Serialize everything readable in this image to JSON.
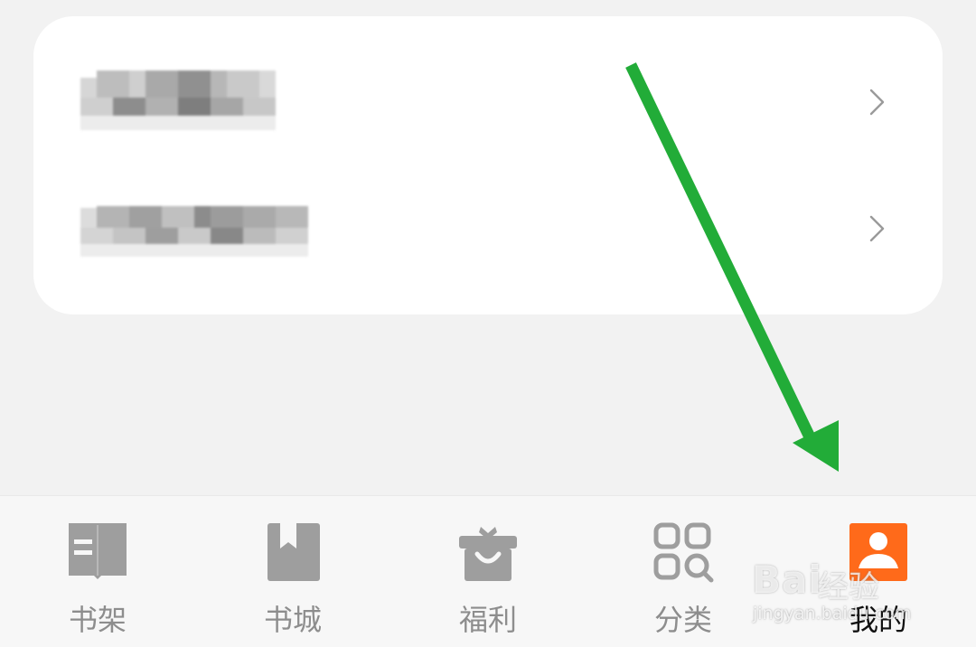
{
  "list": {
    "rows": [
      {
        "label": "",
        "chevron_icon": "chevron-right-icon"
      },
      {
        "label": "",
        "chevron_icon": "chevron-right-icon"
      }
    ]
  },
  "tabbar": {
    "active_color": "#ff6a1a",
    "tabs": [
      {
        "label": "书架",
        "icon": "bookshelf-icon",
        "active": false
      },
      {
        "label": "书城",
        "icon": "bookstore-icon",
        "active": false
      },
      {
        "label": "福利",
        "icon": "gift-icon",
        "active": false
      },
      {
        "label": "分类",
        "icon": "category-icon",
        "active": false
      },
      {
        "label": "我的",
        "icon": "profile-icon",
        "active": true
      }
    ]
  },
  "annotation": {
    "arrow_color": "#22ac38"
  },
  "watermark": {
    "brand": "Bai",
    "brand_cn": "经验",
    "url": "jingyan.baidu.com"
  }
}
